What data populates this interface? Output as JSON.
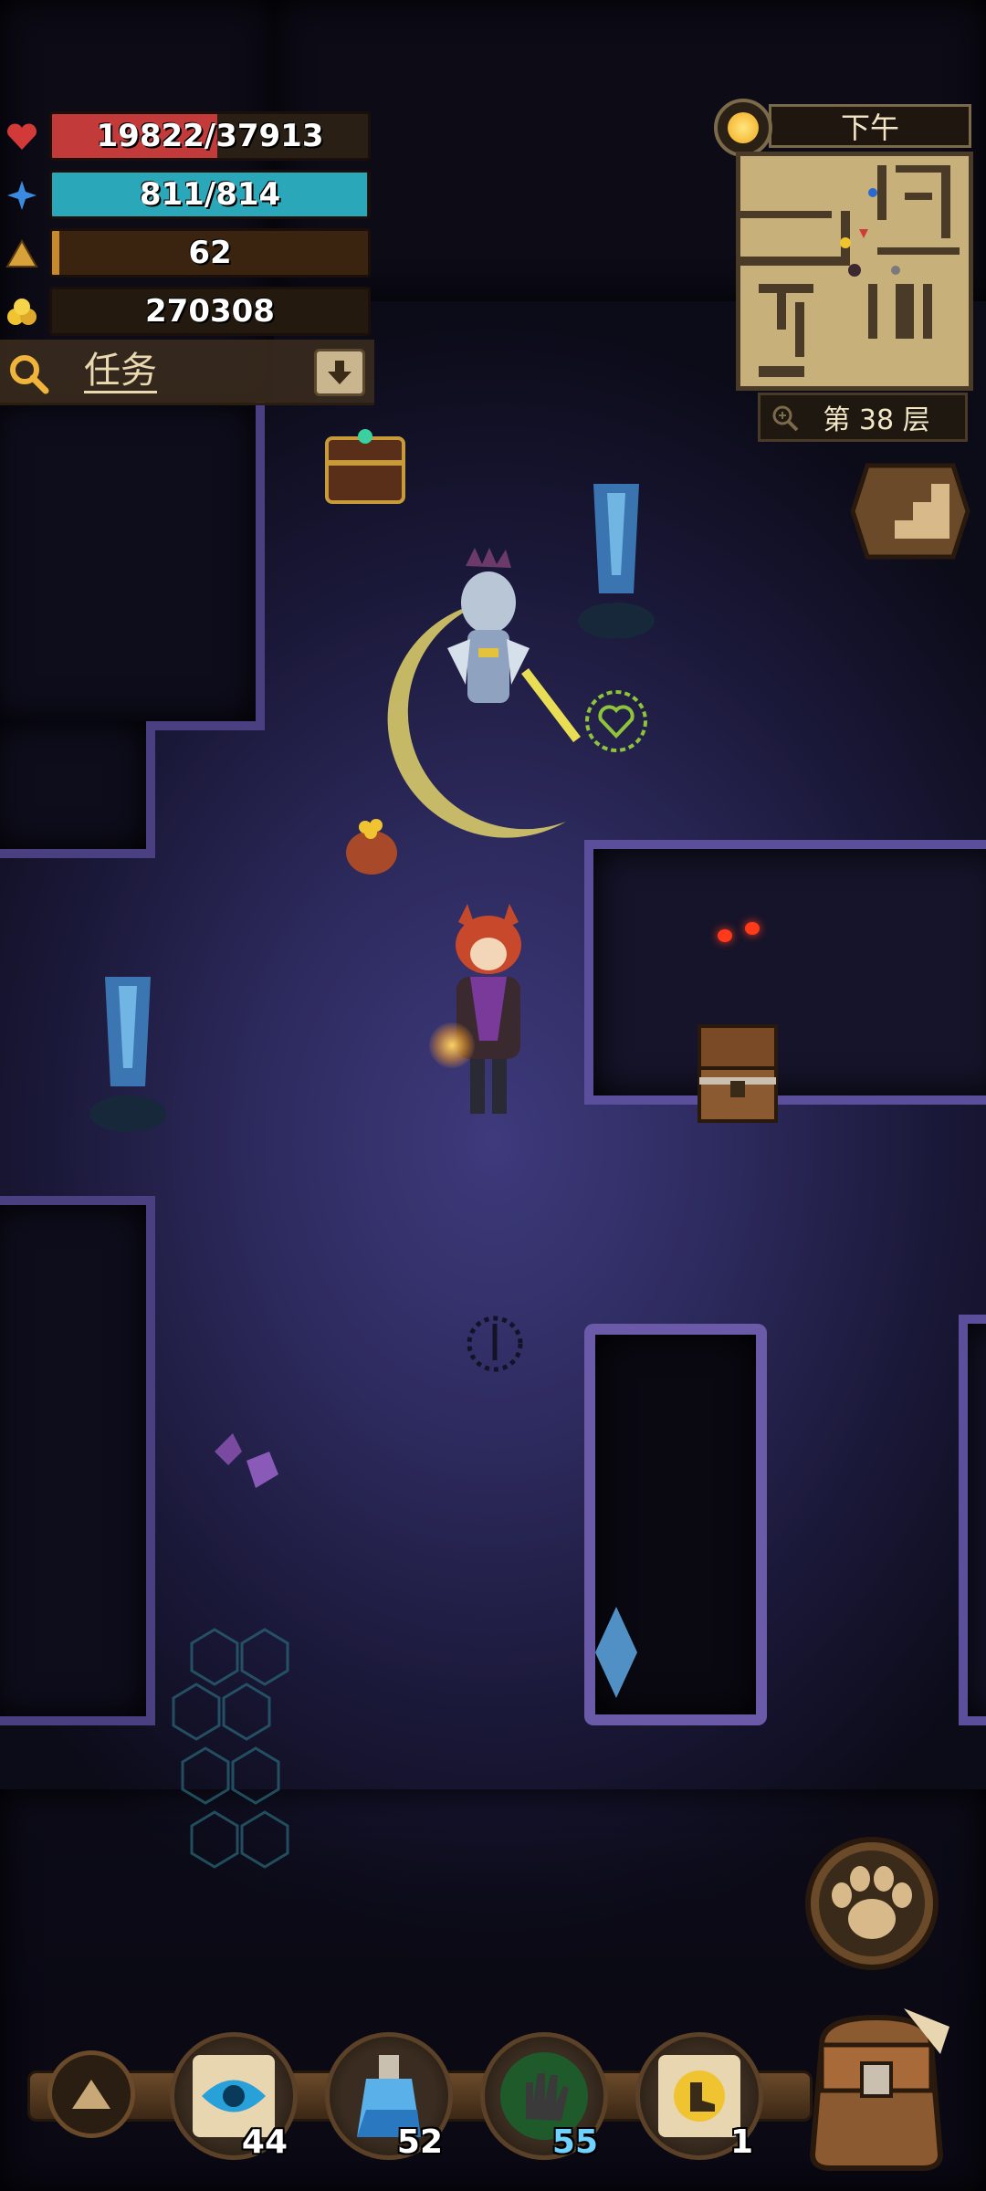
{
  "hud": {
    "hp": {
      "text": "19822/37913",
      "fraction": 0.523,
      "color": "#c23a3a",
      "icon": "heart-icon"
    },
    "mp": {
      "text": "811/814",
      "fraction": 0.996,
      "color": "#2aa7b8",
      "icon": "mana-icon"
    },
    "level": {
      "text": "62",
      "icon": "level-icon"
    },
    "gold": {
      "text": "270308",
      "icon": "gold-icon"
    }
  },
  "task": {
    "label": "任务",
    "toggle_icon": "arrow-down-icon",
    "search_icon": "search-icon"
  },
  "minimap": {
    "time_of_day": "下午",
    "floor": "第 38 层",
    "sun_icon": "sun-icon",
    "zoom_icon": "zoom-icon"
  },
  "buttons": {
    "stairs_icon": "stairs-icon",
    "paw_icon": "paw-icon",
    "backpack_icon": "backpack-icon"
  },
  "toolbar": {
    "up_icon": "up-arrow-icon",
    "items": [
      {
        "icon": "eye-scroll-icon",
        "count": "44",
        "count_color": "#ffffff"
      },
      {
        "icon": "potion-icon",
        "count": "52",
        "count_color": "#ffffff"
      },
      {
        "icon": "green-hand-icon",
        "count": "55",
        "count_color": "#6fd2ff"
      },
      {
        "icon": "boot-scroll-icon",
        "count": "1",
        "count_color": "#ffffff"
      }
    ]
  }
}
